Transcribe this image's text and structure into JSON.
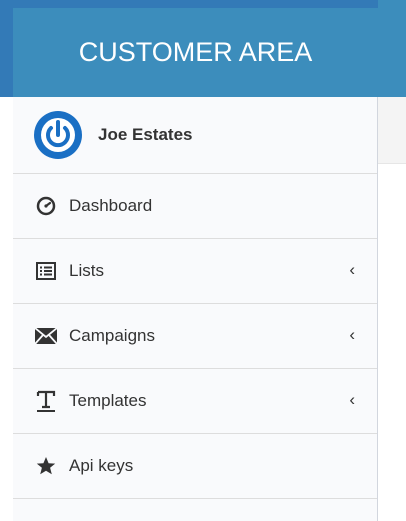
{
  "brand": {
    "title": "CUSTOMER AREA"
  },
  "user": {
    "name": "Joe Estates",
    "avatar_icon": "power-icon"
  },
  "menu": [
    {
      "label": "Dashboard",
      "icon": "dashboard-icon",
      "has_submenu": false
    },
    {
      "label": "Lists",
      "icon": "list-icon",
      "has_submenu": true,
      "chevron": "‹"
    },
    {
      "label": "Campaigns",
      "icon": "envelope-icon",
      "has_submenu": true,
      "chevron": "‹"
    },
    {
      "label": "Templates",
      "icon": "text-icon",
      "has_submenu": true,
      "chevron": "‹"
    },
    {
      "label": "Api keys",
      "icon": "star-icon",
      "has_submenu": false
    }
  ],
  "colors": {
    "header": "#3c8dbc",
    "header_dark": "#337ab7",
    "avatar": "#1a6fc4",
    "text": "#333333"
  }
}
